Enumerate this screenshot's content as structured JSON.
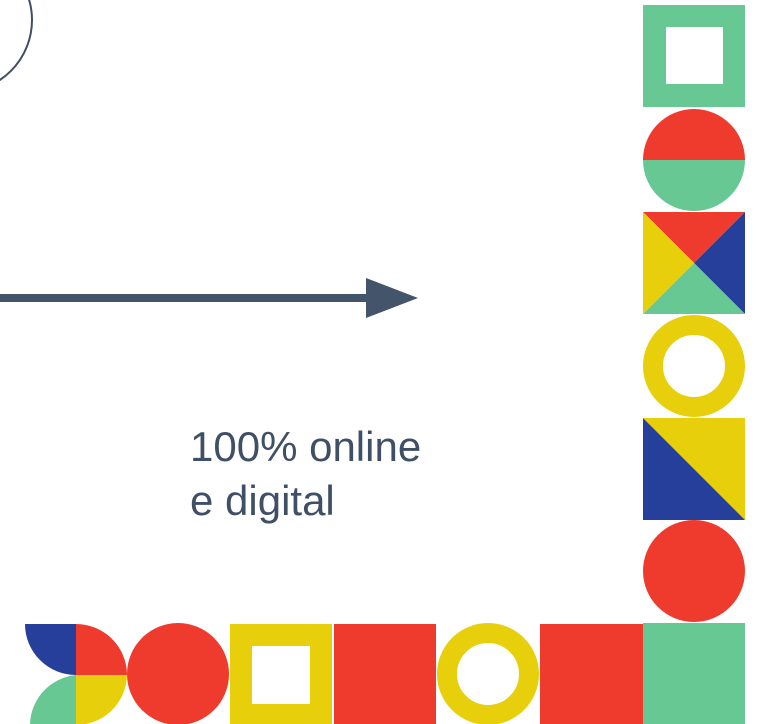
{
  "caption": {
    "line1": "100% online",
    "line2": "e digital"
  },
  "colors": {
    "text": "#3f4f66",
    "arrow": "#3f4f66",
    "green": "#67c893",
    "red": "#ee3b2d",
    "yellow": "#e8cf0c",
    "blue": "#263f9b",
    "white": "#ffffff"
  },
  "icons": [
    "circle-outline-icon",
    "arrow-right-icon",
    "square-frame-icon",
    "half-circle-tile-icon",
    "triangle-quad-icon",
    "ring-icon",
    "diagonal-split-icon",
    "circle-icon",
    "quarter-circles-icon",
    "circle-pair-icon",
    "square-icon"
  ]
}
